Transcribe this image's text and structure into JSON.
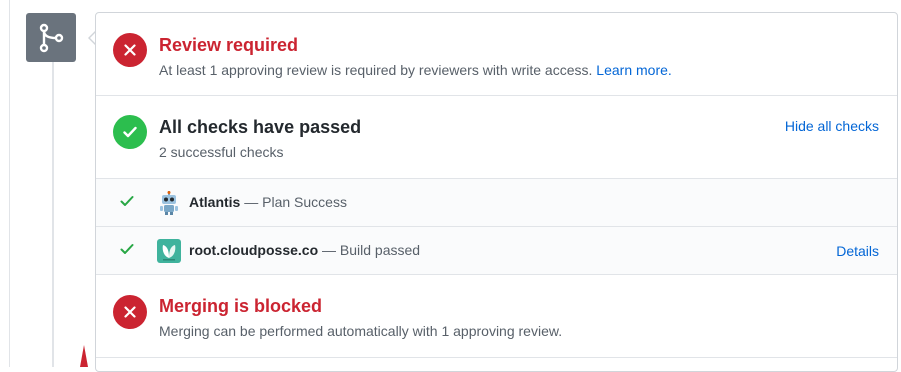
{
  "review": {
    "title": "Review required",
    "message": "At least 1 approving review is required by reviewers with write access.",
    "link": "Learn more."
  },
  "checks_summary": {
    "title": "All checks have passed",
    "subtitle": "2 successful checks",
    "toggle_label": "Hide all checks"
  },
  "checks": [
    {
      "name": "Atlantis",
      "separator": "—",
      "status": "Plan Success",
      "icon": "atlantis-robot-icon",
      "details": ""
    },
    {
      "name": "root.cloudposse.co",
      "separator": "—",
      "status": "Build passed",
      "icon": "codefresh-leaf-icon",
      "details": "Details"
    }
  ],
  "merge": {
    "title": "Merging is blocked",
    "message": "Merging can be performed automatically with 1 approving review."
  },
  "colors": {
    "error": "#cb2431",
    "success": "#2cbe4e",
    "link": "#0366d6",
    "badge": "#6a737d"
  }
}
